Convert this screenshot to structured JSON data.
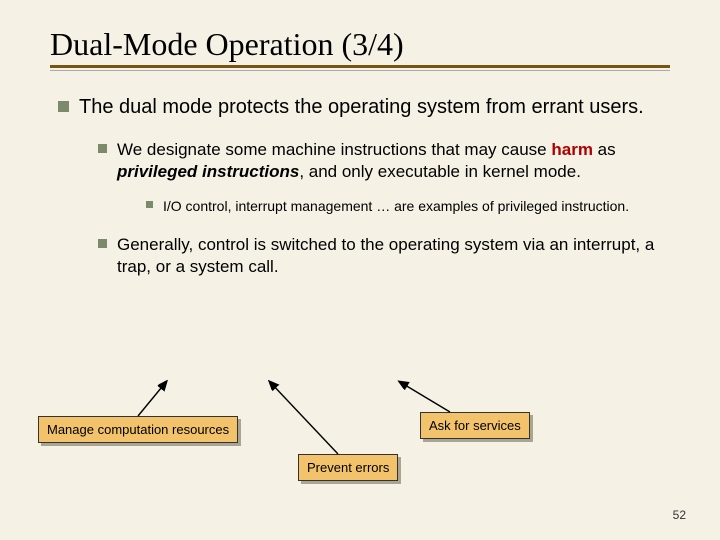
{
  "title": "Dual-Mode Operation (3/4)",
  "bullets": {
    "l1": "The dual mode protects the operating system from errant users.",
    "l2a_pre": "We designate some machine instructions that may cause ",
    "l2a_harm": "harm",
    "l2a_mid": " as ",
    "l2a_priv": "privileged instructions",
    "l2a_post": ", and only executable in kernel mode.",
    "l3": "I/O control, interrupt management … are examples of privileged instruction.",
    "l2b": "Generally, control is switched to the operating system via an interrupt, a trap, or a system call."
  },
  "callouts": {
    "c1": "Manage computation resources",
    "c2": "Prevent errors",
    "c3": "Ask for services"
  },
  "pagenum": "52"
}
